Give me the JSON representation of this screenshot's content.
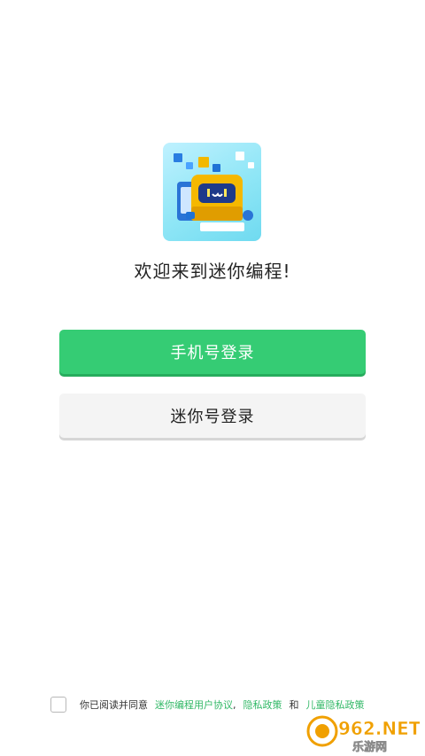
{
  "app_icon": {
    "name": "robot-logo-icon",
    "face_text": "ıwı"
  },
  "welcome_text": "欢迎来到迷你编程!",
  "buttons": {
    "phone_login": "手机号登录",
    "mini_login": "迷你号登录"
  },
  "agreement": {
    "prefix": "你已阅读并同意",
    "user_agreement": "迷你编程用户协议",
    "comma": ",",
    "privacy_policy": "隐私政策",
    "and": "和",
    "children_privacy": "儿童隐私政策"
  },
  "watermark": {
    "brand": "962.NET",
    "sub": "乐游网"
  },
  "colors": {
    "primary": "#35cc74",
    "link": "#31b866",
    "secondary_bg": "#f4f4f4"
  }
}
